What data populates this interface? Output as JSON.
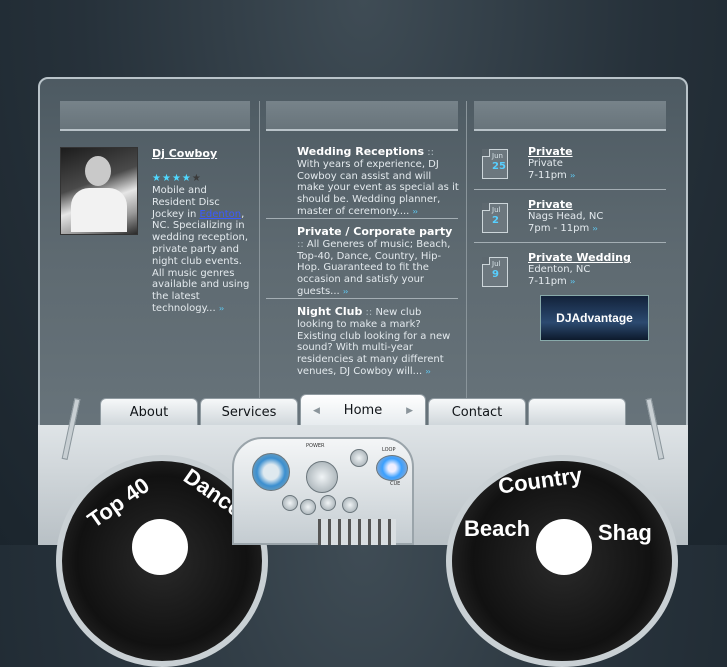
{
  "left_column": {
    "name": "Dj Cowboy",
    "rating": 4,
    "rating_max": 5,
    "bio_before_link": "Mobile and Resident Disc Jockey in ",
    "bio_link": "Edenton",
    "bio_after_link": ", NC. Specializing in wedding reception, private party and night club events. All music genres available and using the latest technology...",
    "more_arrows": "››"
  },
  "services": [
    {
      "title": "Wedding Receptions",
      "sep": " :: ",
      "text": "With years of experience, DJ Cowboy can assist and will make your event as special as it should be. Wedding planner, master of ceremony....",
      "arrows": "››"
    },
    {
      "title": "Private / Corporate party",
      "sep": " :: ",
      "text": "All Generes of music; Beach, Top-40, Dance, Country, Hip-Hop. Guaranteed to fit the occasion and satisfy your guests...",
      "arrows": "››"
    },
    {
      "title": "Night Club",
      "sep": " :: ",
      "text": "New club looking to make a mark? Existing club looking for a new sound? With multi-year residencies at many different venues, DJ Cowboy will...",
      "arrows": "››"
    }
  ],
  "events": [
    {
      "month": "Jun",
      "day": "25",
      "title": "Private",
      "place": "Private",
      "time": "7-11pm",
      "arrows": "››"
    },
    {
      "month": "Jul",
      "day": "2",
      "title": "Private",
      "place": "Nags Head, NC",
      "time": "7pm - 11pm",
      "arrows": "››"
    },
    {
      "month": "Jul",
      "day": "9",
      "title": "Private Wedding",
      "place": "Edenton, NC",
      "time": "7-11pm",
      "arrows": "››"
    }
  ],
  "banner": {
    "text": "DJAdvantage"
  },
  "nav": {
    "items": [
      "About",
      "Services",
      "Home",
      "Contact"
    ],
    "active": "Home"
  },
  "decks": {
    "left": [
      "Top 40",
      "Dance"
    ],
    "right": [
      "Country",
      "Beach",
      "Shag"
    ]
  },
  "mixer": {
    "labels": [
      "POWER",
      "LOOP",
      "CUE"
    ]
  },
  "colors": {
    "accent": "#4fd8ff",
    "link": "#3b5bff",
    "panel": "#5e6a71"
  }
}
